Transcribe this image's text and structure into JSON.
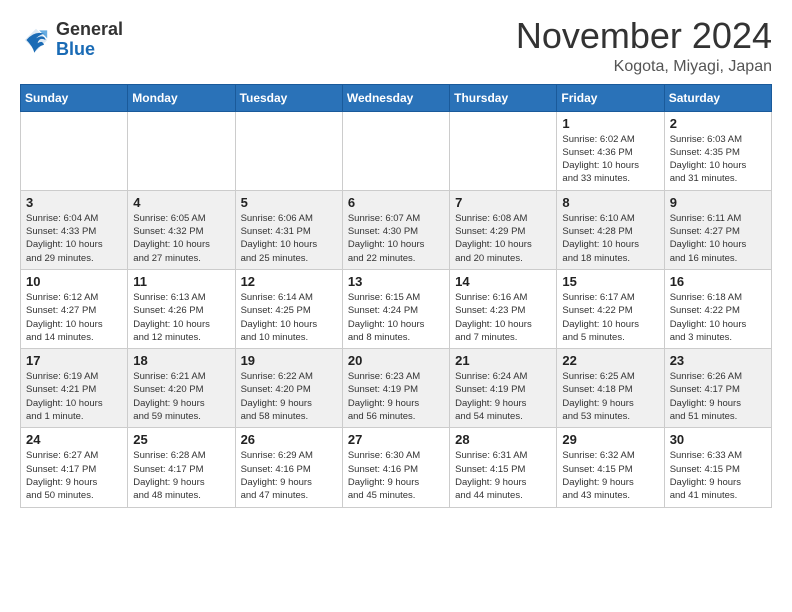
{
  "logo": {
    "general": "General",
    "blue": "Blue"
  },
  "header": {
    "month": "November 2024",
    "location": "Kogota, Miyagi, Japan"
  },
  "weekdays": [
    "Sunday",
    "Monday",
    "Tuesday",
    "Wednesday",
    "Thursday",
    "Friday",
    "Saturday"
  ],
  "weeks": [
    [
      {
        "day": "",
        "info": ""
      },
      {
        "day": "",
        "info": ""
      },
      {
        "day": "",
        "info": ""
      },
      {
        "day": "",
        "info": ""
      },
      {
        "day": "",
        "info": ""
      },
      {
        "day": "1",
        "info": "Sunrise: 6:02 AM\nSunset: 4:36 PM\nDaylight: 10 hours\nand 33 minutes."
      },
      {
        "day": "2",
        "info": "Sunrise: 6:03 AM\nSunset: 4:35 PM\nDaylight: 10 hours\nand 31 minutes."
      }
    ],
    [
      {
        "day": "3",
        "info": "Sunrise: 6:04 AM\nSunset: 4:33 PM\nDaylight: 10 hours\nand 29 minutes."
      },
      {
        "day": "4",
        "info": "Sunrise: 6:05 AM\nSunset: 4:32 PM\nDaylight: 10 hours\nand 27 minutes."
      },
      {
        "day": "5",
        "info": "Sunrise: 6:06 AM\nSunset: 4:31 PM\nDaylight: 10 hours\nand 25 minutes."
      },
      {
        "day": "6",
        "info": "Sunrise: 6:07 AM\nSunset: 4:30 PM\nDaylight: 10 hours\nand 22 minutes."
      },
      {
        "day": "7",
        "info": "Sunrise: 6:08 AM\nSunset: 4:29 PM\nDaylight: 10 hours\nand 20 minutes."
      },
      {
        "day": "8",
        "info": "Sunrise: 6:10 AM\nSunset: 4:28 PM\nDaylight: 10 hours\nand 18 minutes."
      },
      {
        "day": "9",
        "info": "Sunrise: 6:11 AM\nSunset: 4:27 PM\nDaylight: 10 hours\nand 16 minutes."
      }
    ],
    [
      {
        "day": "10",
        "info": "Sunrise: 6:12 AM\nSunset: 4:27 PM\nDaylight: 10 hours\nand 14 minutes."
      },
      {
        "day": "11",
        "info": "Sunrise: 6:13 AM\nSunset: 4:26 PM\nDaylight: 10 hours\nand 12 minutes."
      },
      {
        "day": "12",
        "info": "Sunrise: 6:14 AM\nSunset: 4:25 PM\nDaylight: 10 hours\nand 10 minutes."
      },
      {
        "day": "13",
        "info": "Sunrise: 6:15 AM\nSunset: 4:24 PM\nDaylight: 10 hours\nand 8 minutes."
      },
      {
        "day": "14",
        "info": "Sunrise: 6:16 AM\nSunset: 4:23 PM\nDaylight: 10 hours\nand 7 minutes."
      },
      {
        "day": "15",
        "info": "Sunrise: 6:17 AM\nSunset: 4:22 PM\nDaylight: 10 hours\nand 5 minutes."
      },
      {
        "day": "16",
        "info": "Sunrise: 6:18 AM\nSunset: 4:22 PM\nDaylight: 10 hours\nand 3 minutes."
      }
    ],
    [
      {
        "day": "17",
        "info": "Sunrise: 6:19 AM\nSunset: 4:21 PM\nDaylight: 10 hours\nand 1 minute."
      },
      {
        "day": "18",
        "info": "Sunrise: 6:21 AM\nSunset: 4:20 PM\nDaylight: 9 hours\nand 59 minutes."
      },
      {
        "day": "19",
        "info": "Sunrise: 6:22 AM\nSunset: 4:20 PM\nDaylight: 9 hours\nand 58 minutes."
      },
      {
        "day": "20",
        "info": "Sunrise: 6:23 AM\nSunset: 4:19 PM\nDaylight: 9 hours\nand 56 minutes."
      },
      {
        "day": "21",
        "info": "Sunrise: 6:24 AM\nSunset: 4:19 PM\nDaylight: 9 hours\nand 54 minutes."
      },
      {
        "day": "22",
        "info": "Sunrise: 6:25 AM\nSunset: 4:18 PM\nDaylight: 9 hours\nand 53 minutes."
      },
      {
        "day": "23",
        "info": "Sunrise: 6:26 AM\nSunset: 4:17 PM\nDaylight: 9 hours\nand 51 minutes."
      }
    ],
    [
      {
        "day": "24",
        "info": "Sunrise: 6:27 AM\nSunset: 4:17 PM\nDaylight: 9 hours\nand 50 minutes."
      },
      {
        "day": "25",
        "info": "Sunrise: 6:28 AM\nSunset: 4:17 PM\nDaylight: 9 hours\nand 48 minutes."
      },
      {
        "day": "26",
        "info": "Sunrise: 6:29 AM\nSunset: 4:16 PM\nDaylight: 9 hours\nand 47 minutes."
      },
      {
        "day": "27",
        "info": "Sunrise: 6:30 AM\nSunset: 4:16 PM\nDaylight: 9 hours\nand 45 minutes."
      },
      {
        "day": "28",
        "info": "Sunrise: 6:31 AM\nSunset: 4:15 PM\nDaylight: 9 hours\nand 44 minutes."
      },
      {
        "day": "29",
        "info": "Sunrise: 6:32 AM\nSunset: 4:15 PM\nDaylight: 9 hours\nand 43 minutes."
      },
      {
        "day": "30",
        "info": "Sunrise: 6:33 AM\nSunset: 4:15 PM\nDaylight: 9 hours\nand 41 minutes."
      }
    ]
  ]
}
